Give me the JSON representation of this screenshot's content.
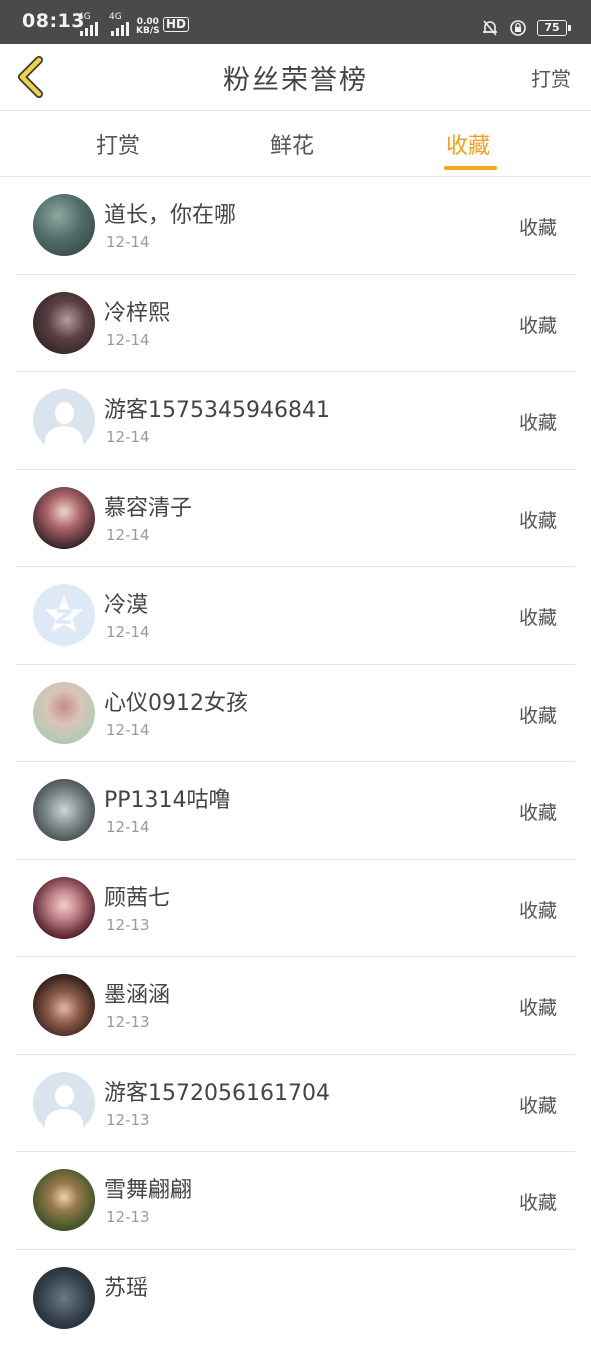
{
  "status_bar": {
    "time": "08:13",
    "sig1_label": "4G",
    "sig2_label": "4G",
    "speed_value": "0.00",
    "speed_unit": "KB/S",
    "hd_label": "HD",
    "battery": "75"
  },
  "header": {
    "title": "粉丝荣誉榜",
    "action_label": "打赏"
  },
  "tabs": [
    {
      "label": "打赏"
    },
    {
      "label": "鲜花"
    },
    {
      "label": "收藏"
    }
  ],
  "active_tab": 2,
  "colors": {
    "accent": "#f5a623",
    "statusbar_bg": "#4a4a4a",
    "back_arrow": "#f2d24a"
  },
  "list": [
    {
      "name": "道长，你在哪",
      "date": "12-14",
      "action": "收藏",
      "avatar": "photo"
    },
    {
      "name": "冷梓熙",
      "date": "12-14",
      "action": "收藏",
      "avatar": "photo"
    },
    {
      "name": "游客1575345946841",
      "date": "12-14",
      "action": "收藏",
      "avatar": "default-user-icon"
    },
    {
      "name": "慕容清子",
      "date": "12-14",
      "action": "收藏",
      "avatar": "photo"
    },
    {
      "name": "冷漠",
      "date": "12-14",
      "action": "收藏",
      "avatar": "qq-icon"
    },
    {
      "name": "心仪0912女孩",
      "date": "12-14",
      "action": "收藏",
      "avatar": "photo"
    },
    {
      "name": "PP1314咕噜",
      "date": "12-14",
      "action": "收藏",
      "avatar": "photo"
    },
    {
      "name": "顾茜七",
      "date": "12-13",
      "action": "收藏",
      "avatar": "photo"
    },
    {
      "name": "墨涵涵",
      "date": "12-13",
      "action": "收藏",
      "avatar": "photo"
    },
    {
      "name": "游客1572056161704",
      "date": "12-13",
      "action": "收藏",
      "avatar": "default-user-icon"
    },
    {
      "name": "雪舞翩翩",
      "date": "12-13",
      "action": "收藏",
      "avatar": "photo"
    },
    {
      "name": "苏瑶",
      "date": "",
      "action": "",
      "avatar": "photo"
    }
  ]
}
